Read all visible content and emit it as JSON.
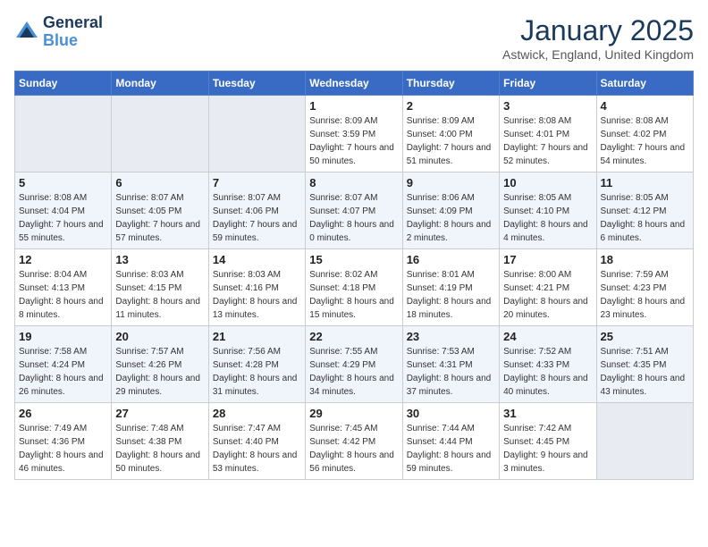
{
  "header": {
    "logo_line1": "General",
    "logo_line2": "Blue",
    "month": "January 2025",
    "location": "Astwick, England, United Kingdom"
  },
  "weekdays": [
    "Sunday",
    "Monday",
    "Tuesday",
    "Wednesday",
    "Thursday",
    "Friday",
    "Saturday"
  ],
  "weeks": [
    [
      {
        "day": "",
        "sunrise": "",
        "sunset": "",
        "daylight": ""
      },
      {
        "day": "",
        "sunrise": "",
        "sunset": "",
        "daylight": ""
      },
      {
        "day": "",
        "sunrise": "",
        "sunset": "",
        "daylight": ""
      },
      {
        "day": "1",
        "sunrise": "Sunrise: 8:09 AM",
        "sunset": "Sunset: 3:59 PM",
        "daylight": "Daylight: 7 hours and 50 minutes."
      },
      {
        "day": "2",
        "sunrise": "Sunrise: 8:09 AM",
        "sunset": "Sunset: 4:00 PM",
        "daylight": "Daylight: 7 hours and 51 minutes."
      },
      {
        "day": "3",
        "sunrise": "Sunrise: 8:08 AM",
        "sunset": "Sunset: 4:01 PM",
        "daylight": "Daylight: 7 hours and 52 minutes."
      },
      {
        "day": "4",
        "sunrise": "Sunrise: 8:08 AM",
        "sunset": "Sunset: 4:02 PM",
        "daylight": "Daylight: 7 hours and 54 minutes."
      }
    ],
    [
      {
        "day": "5",
        "sunrise": "Sunrise: 8:08 AM",
        "sunset": "Sunset: 4:04 PM",
        "daylight": "Daylight: 7 hours and 55 minutes."
      },
      {
        "day": "6",
        "sunrise": "Sunrise: 8:07 AM",
        "sunset": "Sunset: 4:05 PM",
        "daylight": "Daylight: 7 hours and 57 minutes."
      },
      {
        "day": "7",
        "sunrise": "Sunrise: 8:07 AM",
        "sunset": "Sunset: 4:06 PM",
        "daylight": "Daylight: 7 hours and 59 minutes."
      },
      {
        "day": "8",
        "sunrise": "Sunrise: 8:07 AM",
        "sunset": "Sunset: 4:07 PM",
        "daylight": "Daylight: 8 hours and 0 minutes."
      },
      {
        "day": "9",
        "sunrise": "Sunrise: 8:06 AM",
        "sunset": "Sunset: 4:09 PM",
        "daylight": "Daylight: 8 hours and 2 minutes."
      },
      {
        "day": "10",
        "sunrise": "Sunrise: 8:05 AM",
        "sunset": "Sunset: 4:10 PM",
        "daylight": "Daylight: 8 hours and 4 minutes."
      },
      {
        "day": "11",
        "sunrise": "Sunrise: 8:05 AM",
        "sunset": "Sunset: 4:12 PM",
        "daylight": "Daylight: 8 hours and 6 minutes."
      }
    ],
    [
      {
        "day": "12",
        "sunrise": "Sunrise: 8:04 AM",
        "sunset": "Sunset: 4:13 PM",
        "daylight": "Daylight: 8 hours and 8 minutes."
      },
      {
        "day": "13",
        "sunrise": "Sunrise: 8:03 AM",
        "sunset": "Sunset: 4:15 PM",
        "daylight": "Daylight: 8 hours and 11 minutes."
      },
      {
        "day": "14",
        "sunrise": "Sunrise: 8:03 AM",
        "sunset": "Sunset: 4:16 PM",
        "daylight": "Daylight: 8 hours and 13 minutes."
      },
      {
        "day": "15",
        "sunrise": "Sunrise: 8:02 AM",
        "sunset": "Sunset: 4:18 PM",
        "daylight": "Daylight: 8 hours and 15 minutes."
      },
      {
        "day": "16",
        "sunrise": "Sunrise: 8:01 AM",
        "sunset": "Sunset: 4:19 PM",
        "daylight": "Daylight: 8 hours and 18 minutes."
      },
      {
        "day": "17",
        "sunrise": "Sunrise: 8:00 AM",
        "sunset": "Sunset: 4:21 PM",
        "daylight": "Daylight: 8 hours and 20 minutes."
      },
      {
        "day": "18",
        "sunrise": "Sunrise: 7:59 AM",
        "sunset": "Sunset: 4:23 PM",
        "daylight": "Daylight: 8 hours and 23 minutes."
      }
    ],
    [
      {
        "day": "19",
        "sunrise": "Sunrise: 7:58 AM",
        "sunset": "Sunset: 4:24 PM",
        "daylight": "Daylight: 8 hours and 26 minutes."
      },
      {
        "day": "20",
        "sunrise": "Sunrise: 7:57 AM",
        "sunset": "Sunset: 4:26 PM",
        "daylight": "Daylight: 8 hours and 29 minutes."
      },
      {
        "day": "21",
        "sunrise": "Sunrise: 7:56 AM",
        "sunset": "Sunset: 4:28 PM",
        "daylight": "Daylight: 8 hours and 31 minutes."
      },
      {
        "day": "22",
        "sunrise": "Sunrise: 7:55 AM",
        "sunset": "Sunset: 4:29 PM",
        "daylight": "Daylight: 8 hours and 34 minutes."
      },
      {
        "day": "23",
        "sunrise": "Sunrise: 7:53 AM",
        "sunset": "Sunset: 4:31 PM",
        "daylight": "Daylight: 8 hours and 37 minutes."
      },
      {
        "day": "24",
        "sunrise": "Sunrise: 7:52 AM",
        "sunset": "Sunset: 4:33 PM",
        "daylight": "Daylight: 8 hours and 40 minutes."
      },
      {
        "day": "25",
        "sunrise": "Sunrise: 7:51 AM",
        "sunset": "Sunset: 4:35 PM",
        "daylight": "Daylight: 8 hours and 43 minutes."
      }
    ],
    [
      {
        "day": "26",
        "sunrise": "Sunrise: 7:49 AM",
        "sunset": "Sunset: 4:36 PM",
        "daylight": "Daylight: 8 hours and 46 minutes."
      },
      {
        "day": "27",
        "sunrise": "Sunrise: 7:48 AM",
        "sunset": "Sunset: 4:38 PM",
        "daylight": "Daylight: 8 hours and 50 minutes."
      },
      {
        "day": "28",
        "sunrise": "Sunrise: 7:47 AM",
        "sunset": "Sunset: 4:40 PM",
        "daylight": "Daylight: 8 hours and 53 minutes."
      },
      {
        "day": "29",
        "sunrise": "Sunrise: 7:45 AM",
        "sunset": "Sunset: 4:42 PM",
        "daylight": "Daylight: 8 hours and 56 minutes."
      },
      {
        "day": "30",
        "sunrise": "Sunrise: 7:44 AM",
        "sunset": "Sunset: 4:44 PM",
        "daylight": "Daylight: 8 hours and 59 minutes."
      },
      {
        "day": "31",
        "sunrise": "Sunrise: 7:42 AM",
        "sunset": "Sunset: 4:45 PM",
        "daylight": "Daylight: 9 hours and 3 minutes."
      },
      {
        "day": "",
        "sunrise": "",
        "sunset": "",
        "daylight": ""
      }
    ]
  ]
}
